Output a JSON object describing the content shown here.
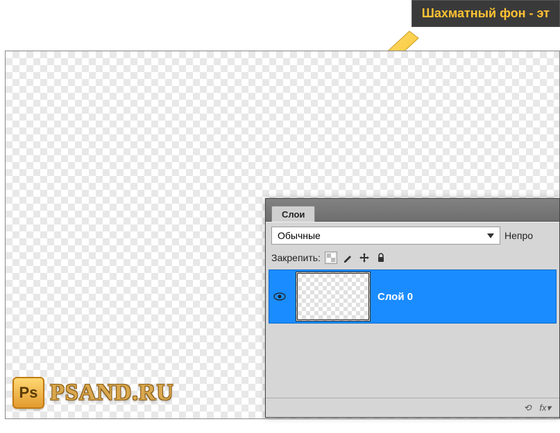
{
  "tooltip": {
    "text": "Шахматный фон - эт"
  },
  "panel": {
    "tab": "Слои",
    "blend_mode": "Обычные",
    "opacity_label": "Непро",
    "lock_label": "Закрепить:",
    "layer": {
      "name": "Слой 0"
    },
    "footer": {
      "link": "⟲",
      "fx": "fx▾"
    }
  },
  "watermark": {
    "logo": "Ps",
    "text": "PSAND.RU"
  }
}
